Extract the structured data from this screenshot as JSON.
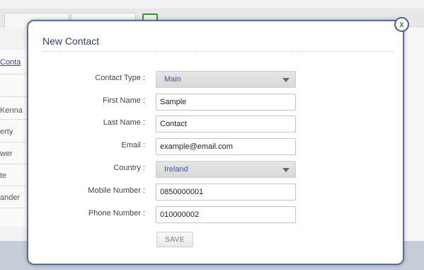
{
  "background": {
    "sidebar_items": [
      "Conta",
      "Kenna",
      "erty",
      "wer",
      "te",
      "ander"
    ]
  },
  "modal": {
    "title": "New Contact",
    "close_label": "x",
    "fields": {
      "contact_type": {
        "label": "Contact Type :",
        "value": "Main"
      },
      "first_name": {
        "label": "First Name :",
        "value": "Sample"
      },
      "last_name": {
        "label": "Last Name :",
        "value": "Contact"
      },
      "email": {
        "label": "Email :",
        "value": "example@email.com"
      },
      "country": {
        "label": "Country :",
        "value": "Ireland"
      },
      "mobile_number": {
        "label": "Mobile Number :",
        "value": "0850000001"
      },
      "phone_number": {
        "label": "Phone Number :",
        "value": "010000002"
      }
    },
    "save_label": "SAVE"
  },
  "colors": {
    "modal_border": "#5c6e96",
    "title_text": "#2f3f6b",
    "select_text": "#3e5a9e"
  }
}
